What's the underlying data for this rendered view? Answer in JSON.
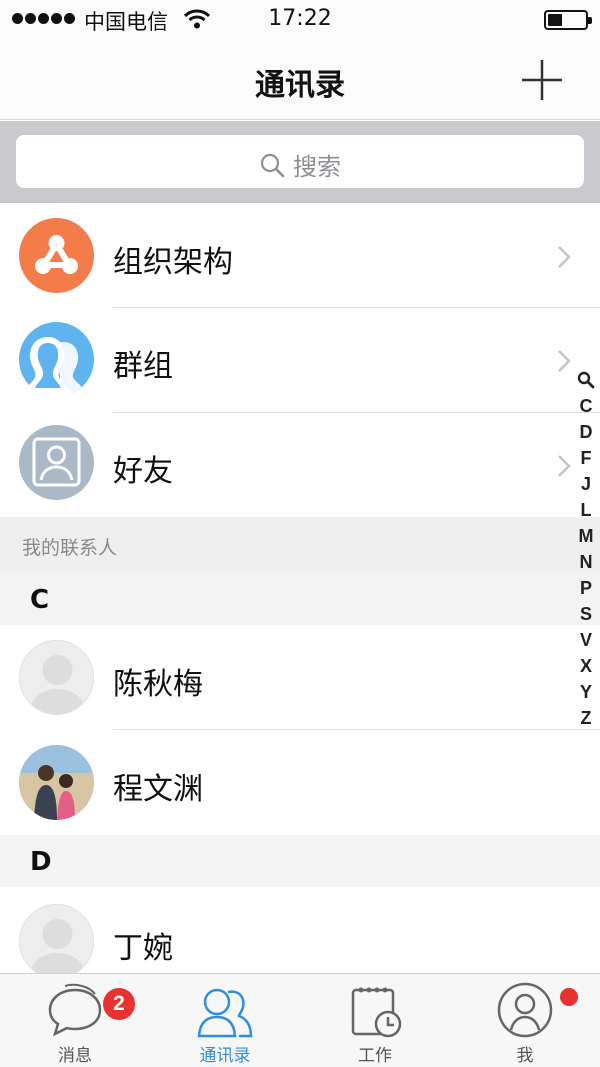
{
  "status_bar": {
    "carrier": "中国电信",
    "time": "17:22"
  },
  "nav": {
    "title": "通讯录"
  },
  "search": {
    "placeholder": "搜索"
  },
  "categories": [
    {
      "label": "组织架构",
      "icon": "org-structure-icon",
      "color": "#f47c4a"
    },
    {
      "label": "群组",
      "icon": "group-icon",
      "color": "#5fb4f0"
    },
    {
      "label": "好友",
      "icon": "friend-icon",
      "color": "#a9b9c8"
    }
  ],
  "my_contacts_header": "我的联系人",
  "sections": [
    {
      "letter": "C",
      "contacts": [
        "陈秋梅",
        "程文渊"
      ]
    },
    {
      "letter": "D",
      "contacts": [
        "丁婉"
      ]
    }
  ],
  "index_letters": [
    "C",
    "D",
    "F",
    "J",
    "L",
    "M",
    "N",
    "P",
    "S",
    "V",
    "X",
    "Y",
    "Z"
  ],
  "tabs": [
    {
      "label": "消息",
      "badge": "2"
    },
    {
      "label": "通讯录"
    },
    {
      "label": "工作"
    },
    {
      "label": "我"
    }
  ],
  "colors": {
    "accent": "#2f8ede",
    "badge": "#e8322f"
  }
}
